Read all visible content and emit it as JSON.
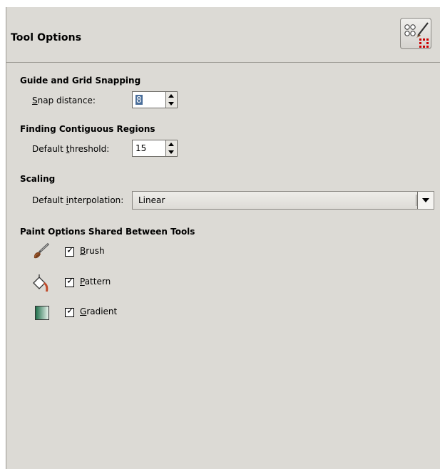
{
  "header": {
    "title": "Tool Options",
    "icon": "preferences-tool-options-icon"
  },
  "guide_grid": {
    "title": "Guide and Grid Snapping",
    "label_mnemonic": "S",
    "label_rest": "nap distance:",
    "value": "8"
  },
  "contiguous": {
    "title": "Finding Contiguous Regions",
    "label_pre": "Default ",
    "label_mnemonic": "t",
    "label_rest": "hreshold:",
    "value": "15"
  },
  "scaling": {
    "title": "Scaling",
    "label_pre": "Default ",
    "label_mnemonic": "i",
    "label_rest": "nterpolation:",
    "value": "Linear"
  },
  "paint_options": {
    "title": "Paint Options Shared Between Tools",
    "items": [
      {
        "icon": "brush-icon",
        "mnemonic": "B",
        "rest": "rush",
        "checked": true
      },
      {
        "icon": "pattern-bucket-icon",
        "mnemonic": "P",
        "rest": "attern",
        "checked": true
      },
      {
        "icon": "gradient-icon",
        "mnemonic": "G",
        "rest": "radient",
        "checked": true
      }
    ]
  },
  "colors": {
    "panel_bg": "#dcdad5",
    "selection": "#4a6e9a",
    "gradient_start": "#1f6e4a",
    "gradient_end": "#e8f2ec"
  }
}
